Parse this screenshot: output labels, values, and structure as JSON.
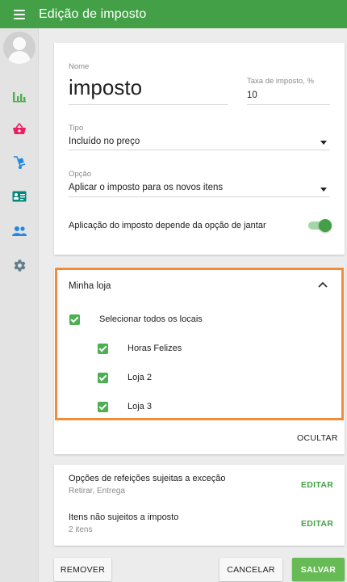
{
  "header": {
    "title": "Edição de imposto"
  },
  "sidebar": {
    "items": [
      {
        "icon": "bar-chart-icon"
      },
      {
        "icon": "basket-icon"
      },
      {
        "icon": "hand-truck-icon"
      },
      {
        "icon": "id-card-icon"
      },
      {
        "icon": "users-icon"
      },
      {
        "icon": "gear-icon"
      }
    ]
  },
  "form": {
    "name_label": "Nome",
    "name_value": "imposto",
    "rate_label": "Taxa de imposto, %",
    "rate_value": "10",
    "type_label": "Tipo",
    "type_value": "Incluído no preço",
    "option_label": "Opção",
    "option_value": "Aplicar o imposto para os novos itens",
    "dining_toggle_label": "Aplicação do imposto depende da opção de jantar",
    "dining_toggle_on": true
  },
  "locations": {
    "store_name": "Minha loja",
    "select_all": "Selecionar todos os locais",
    "items": [
      {
        "label": "Horas Felizes",
        "checked": true
      },
      {
        "label": "Loja 2",
        "checked": true
      },
      {
        "label": "Loja 3",
        "checked": true
      }
    ],
    "hide_label": "OCULTAR"
  },
  "exceptions": {
    "dining_title": "Opções de refeições sujeitas a exceção",
    "dining_sub": "Retirar, Entrega",
    "items_title": "Itens não sujeitos a imposto",
    "items_sub": "2 itens",
    "edit_label": "EDITAR"
  },
  "actions": {
    "remove": "REMOVER",
    "cancel": "CANCELAR",
    "save": "SALVAR"
  },
  "colors": {
    "primary": "#43a047",
    "highlight": "#f28c3b",
    "sidebar_icon": "#4caf50"
  }
}
